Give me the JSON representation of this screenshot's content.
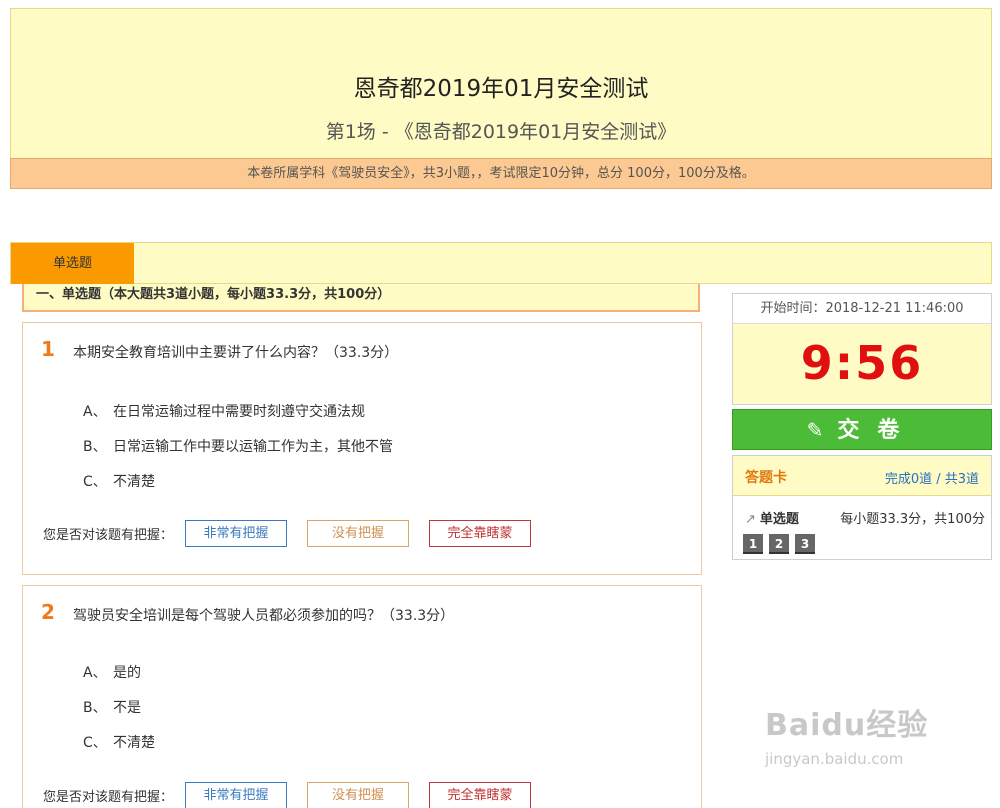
{
  "exam": {
    "title": "恩奇都2019年01月安全测试",
    "subtitle": "第1场 - 《恩奇都2019年01月安全测试》",
    "info": "本卷所属学科《驾驶员安全》，共3小题，，考试限定10分钟，总分 100分，100分及格。"
  },
  "tabs": {
    "active": "单选题"
  },
  "section": {
    "heading": "一、单选题（本大题共3道小题，每小题33.3分，共100分）"
  },
  "confidence": {
    "label": "您是否对该题有把握：",
    "options": [
      "非常有把握",
      "没有把握",
      "完全靠瞎蒙"
    ]
  },
  "questions": [
    {
      "number": "1",
      "text": "本期安全教育培训中主要讲了什么内容？（33.3分）",
      "options": [
        {
          "letter": "A、",
          "text": "在日常运输过程中需要时刻遵守交通法规"
        },
        {
          "letter": "B、",
          "text": "日常运输工作中要以运输工作为主，其他不管"
        },
        {
          "letter": "C、",
          "text": "不清楚"
        }
      ]
    },
    {
      "number": "2",
      "text": "驾驶员安全培训是每个驾驶人员都必须参加的吗？（33.3分）",
      "options": [
        {
          "letter": "A、",
          "text": "是的"
        },
        {
          "letter": "B、",
          "text": "不是"
        },
        {
          "letter": "C、",
          "text": "不清楚"
        }
      ]
    }
  ],
  "sidebar": {
    "start_time": "开始时间：2018-12-21 11:46:00",
    "timer": "9:56",
    "submit_icon": "edit-icon",
    "submit_label": "交卷",
    "card_title": "答题卡",
    "card_progress": "完成0道 / 共3道",
    "card_type": "单选题",
    "card_score": "每小题33.3分，共100分",
    "question_nav": [
      "1",
      "2",
      "3"
    ]
  },
  "watermark": {
    "logo": "Baidu经验",
    "url": "jingyan.baidu.com"
  },
  "colors": {
    "header_bg": "#fffbc4",
    "info_bar": "#fbc991",
    "tab_active": "#fb9a00",
    "question_number": "#f07a1a",
    "timer": "#e01010",
    "submit": "#4cbb38",
    "link": "#2a6fc0"
  }
}
